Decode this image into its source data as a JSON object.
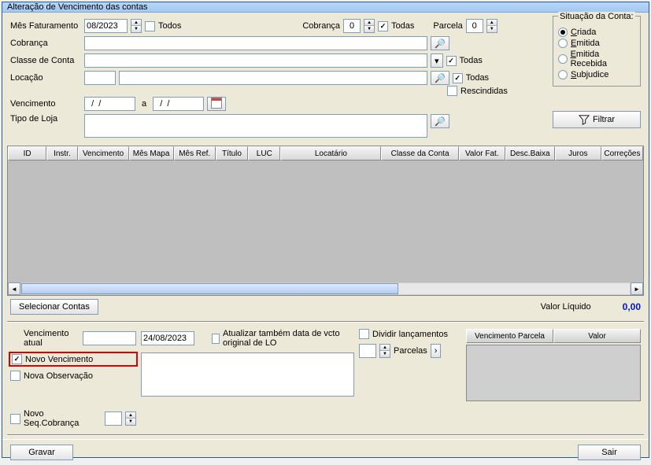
{
  "title": "Alteração de Vencimento das contas",
  "labels": {
    "mesFat": "Mês Faturamento",
    "todos": "Todos",
    "cobranca": "Cobrança",
    "todas": "Todas",
    "parcela": "Parcela",
    "cobranca2": "Cobrança",
    "classeConta": "Classe de Conta",
    "locacao": "Locação",
    "rescindidas": "Rescindidas",
    "vencimento": "Vencimento",
    "a": "a",
    "tipoLoja": "Tipo de Loja"
  },
  "values": {
    "mesFat": "08/2023",
    "cobranca": "0",
    "parcela": "0",
    "venc1": "  /  /    ",
    "venc2": "  /  /    "
  },
  "situacao": {
    "legend": "Situação da Conta:",
    "options": [
      "Criada",
      "Emitida",
      "Emitida Recebida",
      "Subjudice"
    ],
    "selected": 0
  },
  "btns": {
    "filtrar": "Filtrar",
    "selecionar": "Selecionar Contas",
    "gravar": "Gravar",
    "sair": "Sair"
  },
  "gridHeaders": [
    "ID",
    "Instr.",
    "Vencimento",
    "Mês Mapa",
    "Mês Ref.",
    "Título",
    "LUC",
    "Locatário",
    "Classe da Conta",
    "Valor Fat.",
    "Desc.Baixa",
    "Juros",
    "Correções"
  ],
  "gridWidths": [
    50,
    40,
    66,
    58,
    54,
    42,
    42,
    130,
    100,
    60,
    64,
    60,
    54
  ],
  "valorLiquidoLabel": "Valor Líquido",
  "valorLiquido": "0,00",
  "bottom": {
    "vencAtual": "Vencimento atual",
    "novoVenc": "Novo Vencimento",
    "novoVencVal": "24/08/2023",
    "novaObs": "Nova Observação",
    "novoSeq": "Novo Seq.Cobrança",
    "atualizarLO": "Atualizar também data de vcto original de LO",
    "dividir": "Dividir lançamentos",
    "parcelas": "Parcelas",
    "miniHead1": "Vencimento Parcela",
    "miniHead2": "Valor"
  }
}
